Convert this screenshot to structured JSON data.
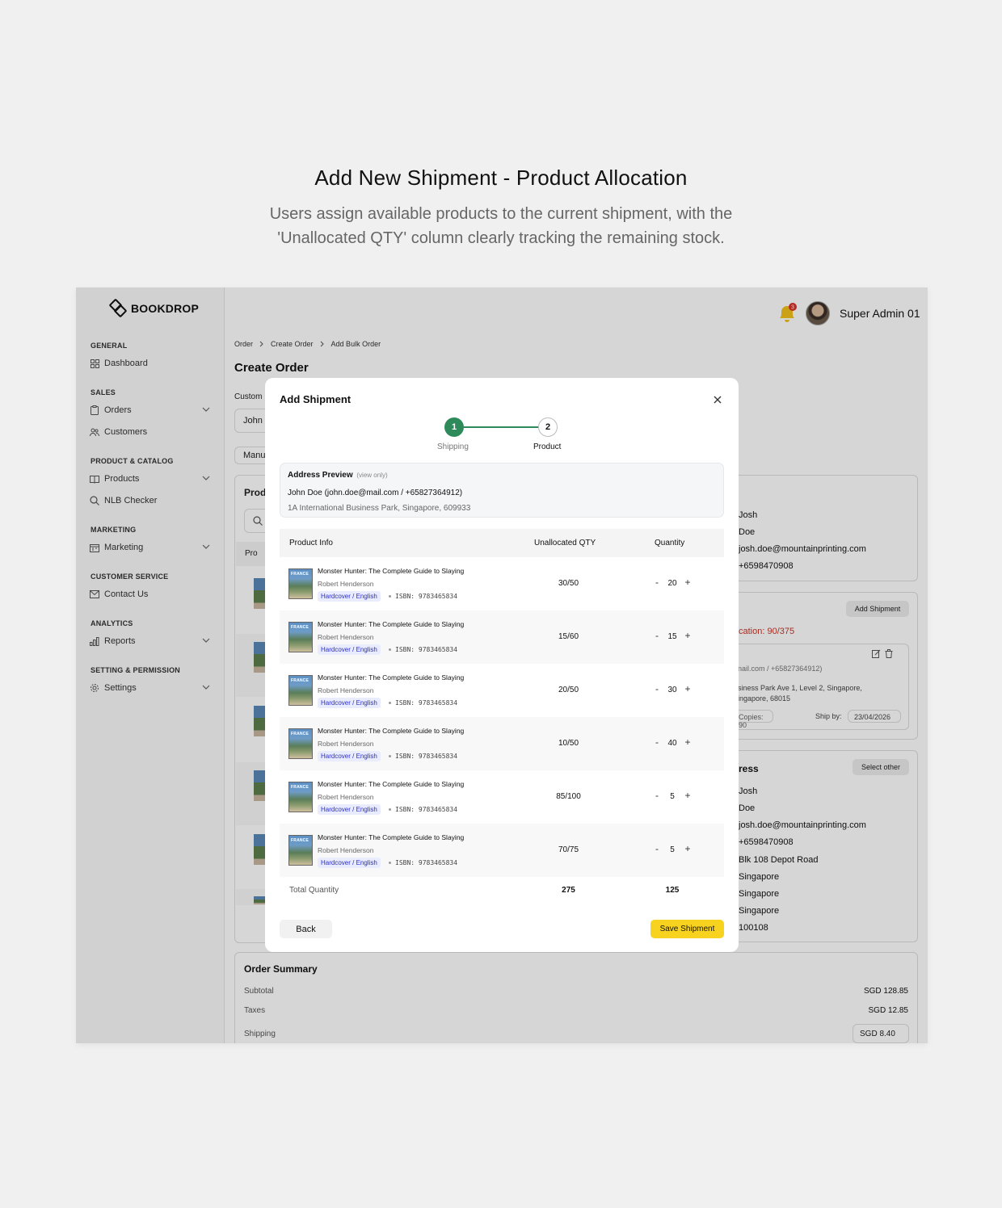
{
  "hero": {
    "title": "Add New Shipment - Product Allocation",
    "subtitle": "Users assign available products to the current shipment, with the 'Unallocated QTY' column clearly tracking the remaining stock."
  },
  "brand": {
    "name": "BOOKDROP"
  },
  "sidebar": {
    "sections": {
      "general": "GENERAL",
      "sales": "SALES",
      "product_catalog": "PRODUCT & CATALOG",
      "marketing": "MARKETING",
      "customer_service": "CUSTOMER SERVICE",
      "analytics": "ANALYTICS",
      "setting_permission": "SETTING & PERMISSION"
    },
    "items": {
      "dashboard": "Dashboard",
      "orders": "Orders",
      "customers": "Customers",
      "products": "Products",
      "nlb_checker": "NLB Checker",
      "marketing": "Marketing",
      "contact_us": "Contact Us",
      "reports": "Reports",
      "settings": "Settings"
    }
  },
  "topbar": {
    "notification_count": "3",
    "user_name": "Super Admin 01"
  },
  "breadcrumb": [
    "Order",
    "Create Order",
    "Add Bulk Order"
  ],
  "page": {
    "title": "Create Order",
    "customer_label": "Custom",
    "customer_value": "John",
    "manual_tab": "Manu",
    "products_heading": "Prod",
    "products_col": "Pro"
  },
  "right_panel": {
    "contact": {
      "first_name": "Josh",
      "last_name": "Doe",
      "email": "josh.doe@mountainprinting.com",
      "phone": "+6598470908"
    },
    "add_shipment_button": "Add Shipment",
    "allocation": "cation: 90/375",
    "shipment_card": {
      "contact": "nail.com / +65827364912)",
      "address_line1": "siness Park Ave 1, Level 2, Singapore,",
      "address_line2": "ingapore, 68015",
      "copies": "Copies: 90",
      "ship_by_label": "Ship by:",
      "ship_by_value": "23/04/2026"
    },
    "address_heading": "ress",
    "select_other_button": "Select other",
    "address": {
      "first_name": "Josh",
      "last_name": "Doe",
      "email": "josh.doe@mountainprinting.com",
      "phone": "+6598470908",
      "street": "Blk 108 Depot Road",
      "city": "Singapore",
      "state": "Singapore",
      "country": "Singapore",
      "postal": "100108"
    }
  },
  "summary": {
    "title": "Order Summary",
    "subtotal_label": "Subtotal",
    "subtotal": "SGD 128.85",
    "taxes_label": "Taxes",
    "taxes": "SGD 12.85",
    "shipping_label": "Shipping",
    "shipping": "SGD 8.40"
  },
  "modal": {
    "title": "Add Shipment",
    "steps": [
      {
        "number": "1",
        "label": "Shipping"
      },
      {
        "number": "2",
        "label": "Product"
      }
    ],
    "address_preview": {
      "heading": "Address Preview",
      "note": "(view only)",
      "name_line": "John Doe (john.doe@mail.com / +65827364912)",
      "address_line": "1A International Business Park, Singapore, 609933"
    },
    "columns": {
      "product_info": "Product Info",
      "unallocated": "Unallocated QTY",
      "quantity": "Quantity"
    },
    "cover_text": "FRANCE",
    "rows": [
      {
        "title": "Monster Hunter: The Complete Guide to Slaying",
        "author": "Robert Henderson",
        "format": "Hardcover / English",
        "isbn": "ISBN: 9783465834",
        "unallocated": "30/50",
        "qty": "20"
      },
      {
        "title": "Monster Hunter: The Complete Guide to Slaying",
        "author": "Robert Henderson",
        "format": "Hardcover / English",
        "isbn": "ISBN: 9783465834",
        "unallocated": "15/60",
        "qty": "15"
      },
      {
        "title": "Monster Hunter: The Complete Guide to Slaying",
        "author": "Robert Henderson",
        "format": "Hardcover / English",
        "isbn": "ISBN: 9783465834",
        "unallocated": "20/50",
        "qty": "30"
      },
      {
        "title": "Monster Hunter: The Complete Guide to Slaying",
        "author": "Robert Henderson",
        "format": "Hardcover / English",
        "isbn": "ISBN: 9783465834",
        "unallocated": "10/50",
        "qty": "40"
      },
      {
        "title": "Monster Hunter: The Complete Guide to Slaying",
        "author": "Robert Henderson",
        "format": "Hardcover / English",
        "isbn": "ISBN: 9783465834",
        "unallocated": "85/100",
        "qty": "5"
      },
      {
        "title": "Monster Hunter: The Complete Guide to Slaying",
        "author": "Robert Henderson",
        "format": "Hardcover / English",
        "isbn": "ISBN: 9783465834",
        "unallocated": "70/75",
        "qty": "5"
      }
    ],
    "minus_symbol": "-",
    "plus_symbol": "+",
    "total_label": "Total Quantity",
    "total_unallocated": "275",
    "total_quantity": "125",
    "back_button": "Back",
    "save_button": "Save Shipment"
  },
  "colors": {
    "accent_yellow": "#f7d21f",
    "step_green": "#2e8a5a",
    "alert_red": "#c0392b",
    "tag_blue": "#2a2bd1"
  }
}
